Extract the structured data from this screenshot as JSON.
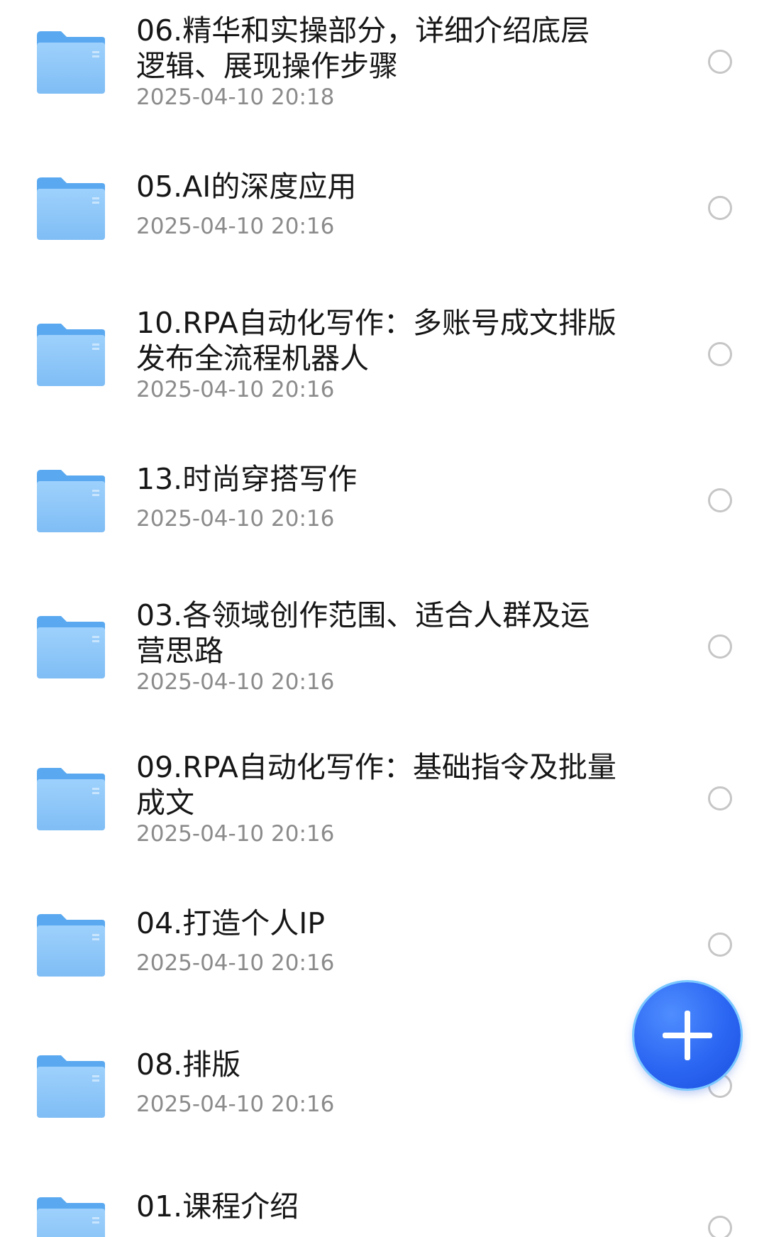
{
  "file_list": {
    "items": [
      {
        "name": "06.精华和实操部分，详细介绍底层\n逻辑、展现操作步骤",
        "modified": "2025-04-10 20:18",
        "icon": "folder-icon"
      },
      {
        "name": "05.AI的深度应用",
        "modified": "2025-04-10 20:16",
        "icon": "folder-icon"
      },
      {
        "name": "10.RPA自动化写作：多账号成文排版\n发布全流程机器人",
        "modified": "2025-04-10 20:16",
        "icon": "folder-icon"
      },
      {
        "name": "13.时尚穿搭写作",
        "modified": "2025-04-10 20:16",
        "icon": "folder-icon"
      },
      {
        "name": "03.各领域创作范围、适合人群及运\n营思路",
        "modified": "2025-04-10 20:16",
        "icon": "folder-icon"
      },
      {
        "name": "09.RPA自动化写作：基础指令及批量\n成文",
        "modified": "2025-04-10 20:16",
        "icon": "folder-icon"
      },
      {
        "name": "04.打造个人IP",
        "modified": "2025-04-10 20:16",
        "icon": "folder-icon"
      },
      {
        "name": "08.排版",
        "modified": "2025-04-10 20:16",
        "icon": "folder-icon"
      },
      {
        "name": "01.课程介绍",
        "modified": "",
        "icon": "folder-icon"
      }
    ]
  },
  "fab": {
    "icon": "plus-icon"
  },
  "colors": {
    "folder_body": "#8cc8fa",
    "folder_tab": "#5aa9f0",
    "fab": "#2a66f2",
    "text_primary": "#161616",
    "text_secondary": "#8b8b8b"
  }
}
